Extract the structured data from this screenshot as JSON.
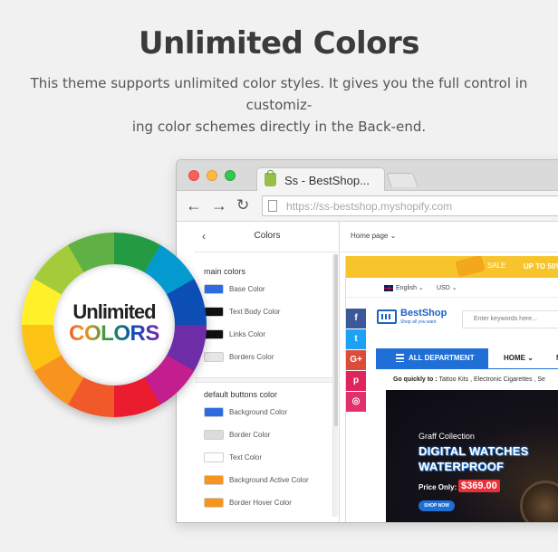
{
  "header": {
    "title": "Unlimited Colors",
    "description": "This theme supports unlimited color styles. It gives you the full control in customizing color schemes directly in the Back-end.",
    "description_line1": "This theme supports unlimited color styles. It gives you the full control in customiz-",
    "description_line2": "ing color schemes directly in the Back-end."
  },
  "badge": {
    "word1": "Unlimited",
    "word2": "COLORS",
    "wheel_colors": [
      "#249b42",
      "#049ad0",
      "#0c4eb3",
      "#6e2da6",
      "#c21e8e",
      "#ea1c2d",
      "#f1582a",
      "#f7931e",
      "#fdc314",
      "#fff02a",
      "#a4cc3a",
      "#5fb045"
    ]
  },
  "browser": {
    "tab_title": "Ss - BestShop...",
    "url": "https://ss-bestshop.myshopify.com",
    "icons": {
      "back": "arrow-left-icon",
      "forward": "arrow-right-icon",
      "reload": "reload-icon"
    }
  },
  "sidebar": {
    "back_icon": "chevron-left-icon",
    "title": "Colors",
    "groups": [
      {
        "label": "main colors",
        "items": [
          {
            "label": "Base Color",
            "color": "#2f6be0"
          },
          {
            "label": "Text Body Color",
            "color": "#111111"
          },
          {
            "label": "Links Color",
            "color": "#111111"
          },
          {
            "label": "Borders Color",
            "color": "#e6e6e6"
          }
        ]
      },
      {
        "label": "default buttons color",
        "items": [
          {
            "label": "Background Color",
            "color": "#2f6be0"
          },
          {
            "label": "Border Color",
            "color": "#dcdcdc"
          },
          {
            "label": "Text Color",
            "color": "#ffffff"
          },
          {
            "label": "Background Active Color",
            "color": "#f7941d"
          },
          {
            "label": "Border Hover Color",
            "color": "#f7941d"
          }
        ]
      }
    ]
  },
  "preview": {
    "page_select": "Home page ⌄",
    "promo": "UP TO 50%",
    "promo_badge": "SALE",
    "language": "English ⌄",
    "currency": "USD ⌄",
    "social": [
      {
        "icon": "facebook-icon",
        "glyph": "f",
        "color": "#3b5998"
      },
      {
        "icon": "twitter-icon",
        "glyph": "t",
        "color": "#1da1f2"
      },
      {
        "icon": "google-plus-icon",
        "glyph": "G+",
        "color": "#dd4b39"
      },
      {
        "icon": "pinterest-icon",
        "glyph": "p",
        "color": "#e0245e"
      },
      {
        "icon": "instagram-icon",
        "glyph": "◎",
        "color": "#e1306c"
      }
    ],
    "logo_name": "BestShop",
    "logo_tagline": "Shop all you want",
    "search_placeholder": "Enter keywords here...",
    "department_button": "ALL DEPARTMENT",
    "nav_home": "HOME ⌄",
    "nav_more": "N",
    "quick_label": "Go quickly to :",
    "quick_links": "Tattoo Kits , Electronic Cigarettes , Se",
    "banner": {
      "kicker": "Graff Collection",
      "title": "DIGITAL WATCHES WATERPROOF",
      "price_label": "Price Only:",
      "price": "$369.00",
      "cta": "SHOP NOW"
    }
  },
  "colors": {
    "accent_blue": "#1f6fd6",
    "promo_yellow": "#f7c52b",
    "price_red": "#e8303a"
  }
}
